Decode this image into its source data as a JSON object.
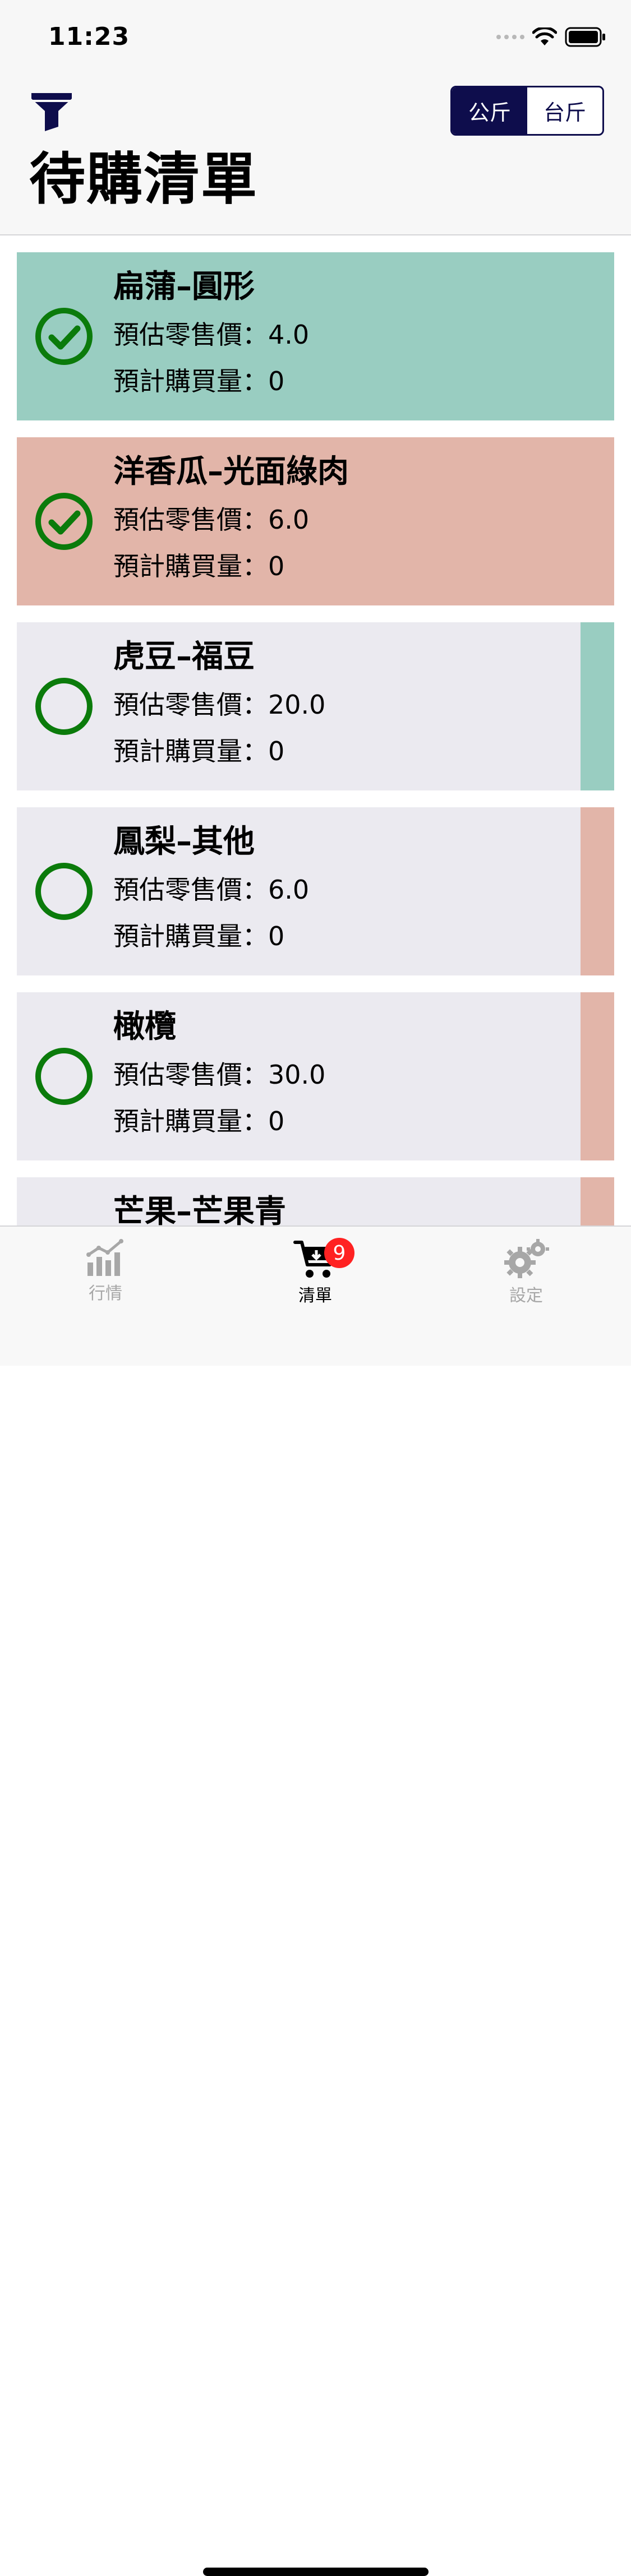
{
  "status_bar": {
    "time": "11:23"
  },
  "header": {
    "title": "待購清單",
    "unit_toggle": {
      "options": [
        "公斤",
        "台斤"
      ],
      "selected": "公斤"
    },
    "filter_icon": "filter-icon"
  },
  "colors": {
    "bought_green": "#99cdc1",
    "bought_red": "#e2b5a9",
    "pending_bg": "#ebeaf0",
    "check_green": "#0b7b0b",
    "navy": "#0e0d4c"
  },
  "items": [
    {
      "name": "扁蒲–圓形",
      "price_line": "預估零售價：4.0",
      "qty_line": "預計購買量：0",
      "checked": true,
      "tone": "green"
    },
    {
      "name": "洋香瓜–光面綠肉",
      "price_line": "預估零售價：6.0",
      "qty_line": "預計購買量：0",
      "checked": true,
      "tone": "red"
    },
    {
      "name": "虎豆–福豆",
      "price_line": "預估零售價：20.0",
      "qty_line": "預計購買量：0",
      "checked": false,
      "tone": "green"
    },
    {
      "name": "鳳梨–其他",
      "price_line": "預估零售價：6.0",
      "qty_line": "預計購買量：0",
      "checked": false,
      "tone": "red"
    },
    {
      "name": "橄欖",
      "price_line": "預估零售價：30.0",
      "qty_line": "預計購買量：0",
      "checked": false,
      "tone": "red"
    },
    {
      "name": "芒果–芒果青",
      "price_line": "",
      "qty_line": "",
      "checked": false,
      "tone": "red"
    }
  ],
  "tabbar": {
    "tabs": [
      {
        "label": "行情",
        "icon": "chart-icon",
        "active": false
      },
      {
        "label": "清單",
        "icon": "cart-icon",
        "active": true,
        "badge": "9"
      },
      {
        "label": "設定",
        "icon": "gear-icon",
        "active": false
      }
    ]
  }
}
